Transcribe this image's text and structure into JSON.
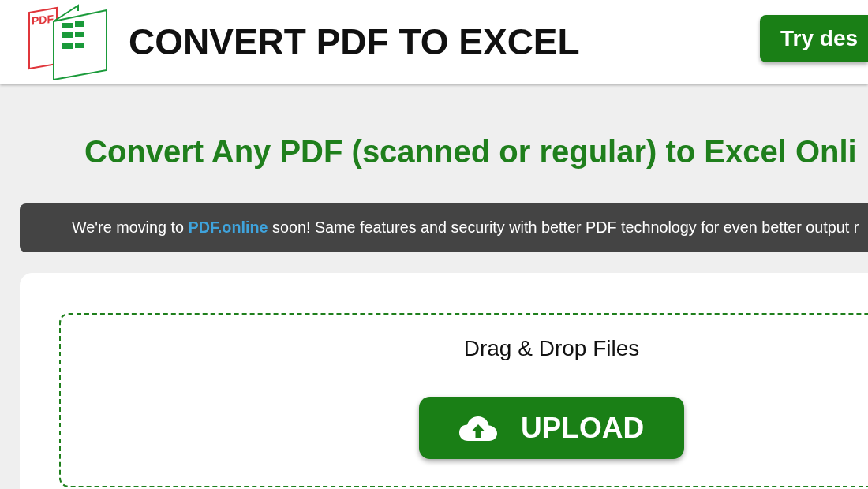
{
  "header": {
    "logo": {
      "mark_text": "PDF"
    },
    "title": "CONVERT PDF TO EXCEL",
    "cta_button": "Try des"
  },
  "headline": "Convert Any PDF (scanned or regular) to Excel Onli",
  "notice": {
    "text_before": "We're moving to",
    "link": "PDF.online",
    "text_after": "soon! Same features and security with better PDF technology for even better output r"
  },
  "upload": {
    "prompt": "Drag & Drop Files",
    "button": "UPLOAD"
  }
}
